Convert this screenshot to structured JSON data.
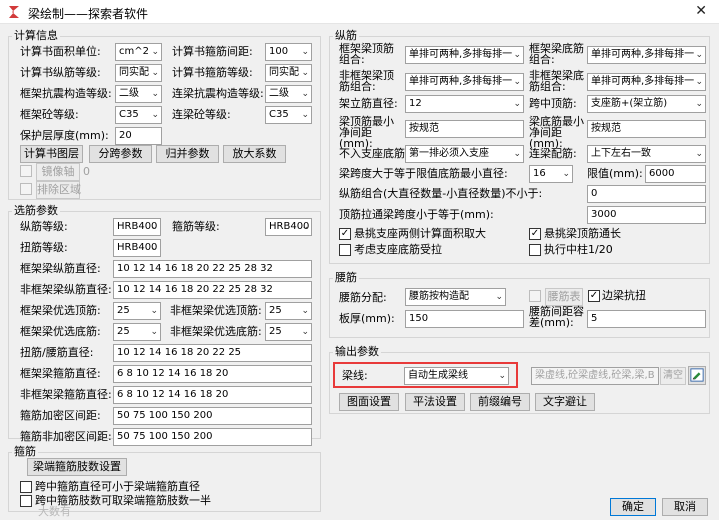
{
  "window": {
    "title": "梁绘制——探索者软件",
    "close_glyph": "✕"
  },
  "calc": {
    "legend": "计算信息",
    "area_unit_label": "计算书面积单位:",
    "area_unit_value": "cm^2",
    "stirrup_spacing_label": "计算书箍筋间距:",
    "stirrup_spacing_value": "100",
    "long_grade_label": "计算书纵筋等级:",
    "long_grade_value": "同实配",
    "stirrup_grade_label": "计算书箍筋等级:",
    "stirrup_grade_value": "同实配",
    "frame_seismic_label": "框架抗震构造等级:",
    "frame_seismic_value": "二级",
    "link_seismic_label": "连梁抗震构造等级:",
    "link_seismic_value": "二级",
    "frame_concrete_label": "框架砼等级:",
    "frame_concrete_value": "C35",
    "link_concrete_label": "连梁砼等级:",
    "link_concrete_value": "C35",
    "cover_label": "保护层厚度(mm):",
    "cover_value": "20",
    "btn_calc_layer": "计算书图层",
    "btn_span_params": "分跨参数",
    "btn_merge_params": "归并参数",
    "btn_amplify": "放大系数",
    "btn_mirror_axis": "镜像轴",
    "mirror_value": "0",
    "btn_exclude_zone": "排除区域"
  },
  "select": {
    "legend": "选筋参数",
    "long_grade_label": "纵筋等级:",
    "long_grade_value": "HRB400",
    "stirrup_grade_label": "箍筋等级:",
    "stirrup_grade_value": "HRB400",
    "torsion_grade_label": "扭筋等级:",
    "torsion_grade_value": "HRB400",
    "frame_long_dia_label": "框架梁纵筋直径:",
    "frame_long_dia_value": "10 12 14 16 18 20 22 25 28 32",
    "nonframe_long_dia_label": "非框架梁纵筋直径:",
    "nonframe_long_dia_value": "10 12 14 16 18 20 22 25 28 32",
    "frame_pref_top_label": "框架梁优选顶筋:",
    "frame_pref_top_value": "25",
    "nonframe_pref_top_label": "非框架梁优选顶筋:",
    "nonframe_pref_top_value": "25",
    "frame_pref_bot_label": "框架梁优选底筋:",
    "frame_pref_bot_value": "25",
    "nonframe_pref_bot_label": "非框架梁优选底筋:",
    "nonframe_pref_bot_value": "25",
    "torsion_waist_dia_label": "扭筋/腰筋直径:",
    "torsion_waist_dia_value": "10 12 14 16 18 20 22 25",
    "frame_stirrup_dia_label": "框架梁箍筋直径:",
    "frame_stirrup_dia_value": "6 8 10 12 14 16 18 20",
    "nonframe_stirrup_dia_label": "非框架梁箍筋直径:",
    "nonframe_stirrup_dia_value": "6 8 10 12 14 16 18 20",
    "stirrup_dense_label": "箍筋加密区间距:",
    "stirrup_dense_value": "50 75 100 150 200",
    "stirrup_nondense_label": "箍筋非加密区间距:",
    "stirrup_nondense_value": "50 75 100 150 200"
  },
  "stirrup": {
    "legend": "箍筋",
    "btn_leg_settings": "梁端箍筋肢数设置",
    "chk1_label": "跨中箍筋直径可小于梁端箍筋直径",
    "chk2_label": "跨中箍筋肢数可取梁端箍筋肢数一半"
  },
  "longitudinal": {
    "legend": "纵筋",
    "frame_top_combo_label": "框架梁顶筋组合:",
    "frame_top_combo_value": "单排可两种,多排每排一",
    "frame_bot_combo_label": "框架梁底筋组合:",
    "frame_bot_combo_value": "单排可两种,多排每排一",
    "nonframe_top_combo_label": "非框架梁顶筋组合:",
    "nonframe_top_combo_value": "单排可两种,多排每排一",
    "nonframe_bot_combo_label": "非框架梁底筋组合:",
    "nonframe_bot_combo_value": "单排可两种,多排每排一",
    "erect_dia_label": "架立筋直径:",
    "erect_dia_value": "12",
    "midspan_top_label": "跨中顶筋:",
    "midspan_top_value": "支座筋+(架立筋)",
    "top_min_spacing_label": "梁顶筋最小净间距(mm):",
    "top_min_spacing_value": "按规范",
    "bot_min_spacing_label": "梁底筋最小净间距(mm):",
    "bot_min_spacing_value": "按规范",
    "no_support_bot_label": "不入支座底筋:",
    "no_support_bot_value": "第一排必须入支座",
    "link_diag_label": "连梁配筋:",
    "link_diag_value": "上下左右一致",
    "span_height_label": "梁跨度大于等于限值底筋最小直径:",
    "span_height_value": "16",
    "limit_label": "限值(mm):",
    "limit_value": "6000",
    "long_combo_label": "纵筋组合(大直径数量-小直径数量)不小于:",
    "long_combo_value": "0",
    "top_through_label": "顶筋拉通梁跨度小于等于(mm):",
    "top_through_value": "3000",
    "chk_take_max_label": "悬挑支座两侧计算面积取大",
    "chk_cantilever_label": "悬挑梁顶筋通长",
    "chk_support_bot_label": "考虑支座底筋受拉",
    "chk_exec_label": "执行中柱1/20"
  },
  "waist": {
    "legend": "腰筋",
    "dist_label": "腰筋分配:",
    "dist_value": "腰筋按构造配",
    "btn_waist_table": "腰筋表",
    "chk_edge_torsion_label": "边梁抗扭",
    "plate_thick_label": "板厚(mm):",
    "plate_thick_value": "150",
    "waist_spacing_label": "腰筋间距容差(mm):",
    "waist_spacing_value": "5"
  },
  "output": {
    "legend": "输出参数",
    "beam_line_label": "梁线:",
    "beam_line_value": "自动生成梁线",
    "layers_value": "梁虚线,砼梁虚线,砼梁,梁,B",
    "btn_clear": "清空",
    "btn_fig_settings": "图面设置",
    "btn_flat_settings": "平法设置",
    "btn_seq_number": "前缀编号",
    "btn_text_avoid": "文字避让"
  },
  "footer": {
    "ok": "确定",
    "cancel": "取消",
    "watermark": "大数有"
  }
}
